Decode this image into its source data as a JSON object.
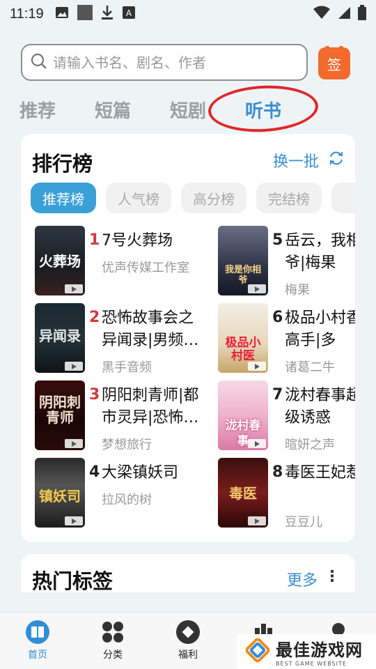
{
  "status_bar": {
    "time": "11:19"
  },
  "search": {
    "placeholder": "请输入书名、剧名、作者"
  },
  "sign_in": {
    "label": "签"
  },
  "top_tabs": [
    {
      "label": "推荐",
      "active": false
    },
    {
      "label": "短篇",
      "active": false
    },
    {
      "label": "短剧",
      "active": false
    },
    {
      "label": "听书",
      "active": true
    }
  ],
  "ranking": {
    "title": "排行榜",
    "refresh_label": "换一批",
    "chips": [
      {
        "label": "推荐榜",
        "active": true
      },
      {
        "label": "人气榜",
        "active": false
      },
      {
        "label": "高分榜",
        "active": false
      },
      {
        "label": "完结榜",
        "active": false
      },
      {
        "label": "热",
        "active": false
      }
    ],
    "books": [
      {
        "rank": "1",
        "title": "7号火葬场",
        "author": "优声传媒工作室",
        "cover_text": "火葬场"
      },
      {
        "rank": "2",
        "title": "恐怖故事会之异闻录|男频…",
        "author": "黑手音频",
        "cover_text": "异闻录"
      },
      {
        "rank": "3",
        "title": "阴阳刺青师|都市灵异|恐怖…",
        "author": "梦想旅行",
        "cover_text": "阴阳刺青师"
      },
      {
        "rank": "4",
        "title": "大梁镇妖司",
        "author": "拉风的树",
        "cover_text": "镇妖司"
      },
      {
        "rank": "5",
        "title": "岳云，我相爷|梅果",
        "author": "梅果",
        "cover_text": "我是你相爷"
      },
      {
        "rank": "6",
        "title": "极品小村香高手|多",
        "author": "诸葛二牛",
        "cover_text": "极品小村医"
      },
      {
        "rank": "7",
        "title": "泷村春事超级诱惑",
        "author": "暄妍之声",
        "cover_text": "泷村春事"
      },
      {
        "rank": "8",
        "title": "毒医王妃惹",
        "author": "豆豆儿",
        "cover_text": "毒医"
      }
    ]
  },
  "tags_section": {
    "title": "热门标签",
    "more_label": "更多",
    "menu_label": "⋮"
  },
  "bottom_nav": [
    {
      "label": "首页",
      "active": true
    },
    {
      "label": "分类",
      "active": false
    },
    {
      "label": "福利",
      "active": false
    },
    {
      "label": "",
      "active": false
    },
    {
      "label": "",
      "active": false
    }
  ],
  "watermark": {
    "main": "最佳游戏网",
    "sub": "BEST GAME WEBSITE"
  },
  "colors": {
    "accent": "#3a8fd0",
    "rank_red": "#d43b3b",
    "sign_orange": "#f26a2e",
    "highlight_circle": "#e0262a"
  }
}
